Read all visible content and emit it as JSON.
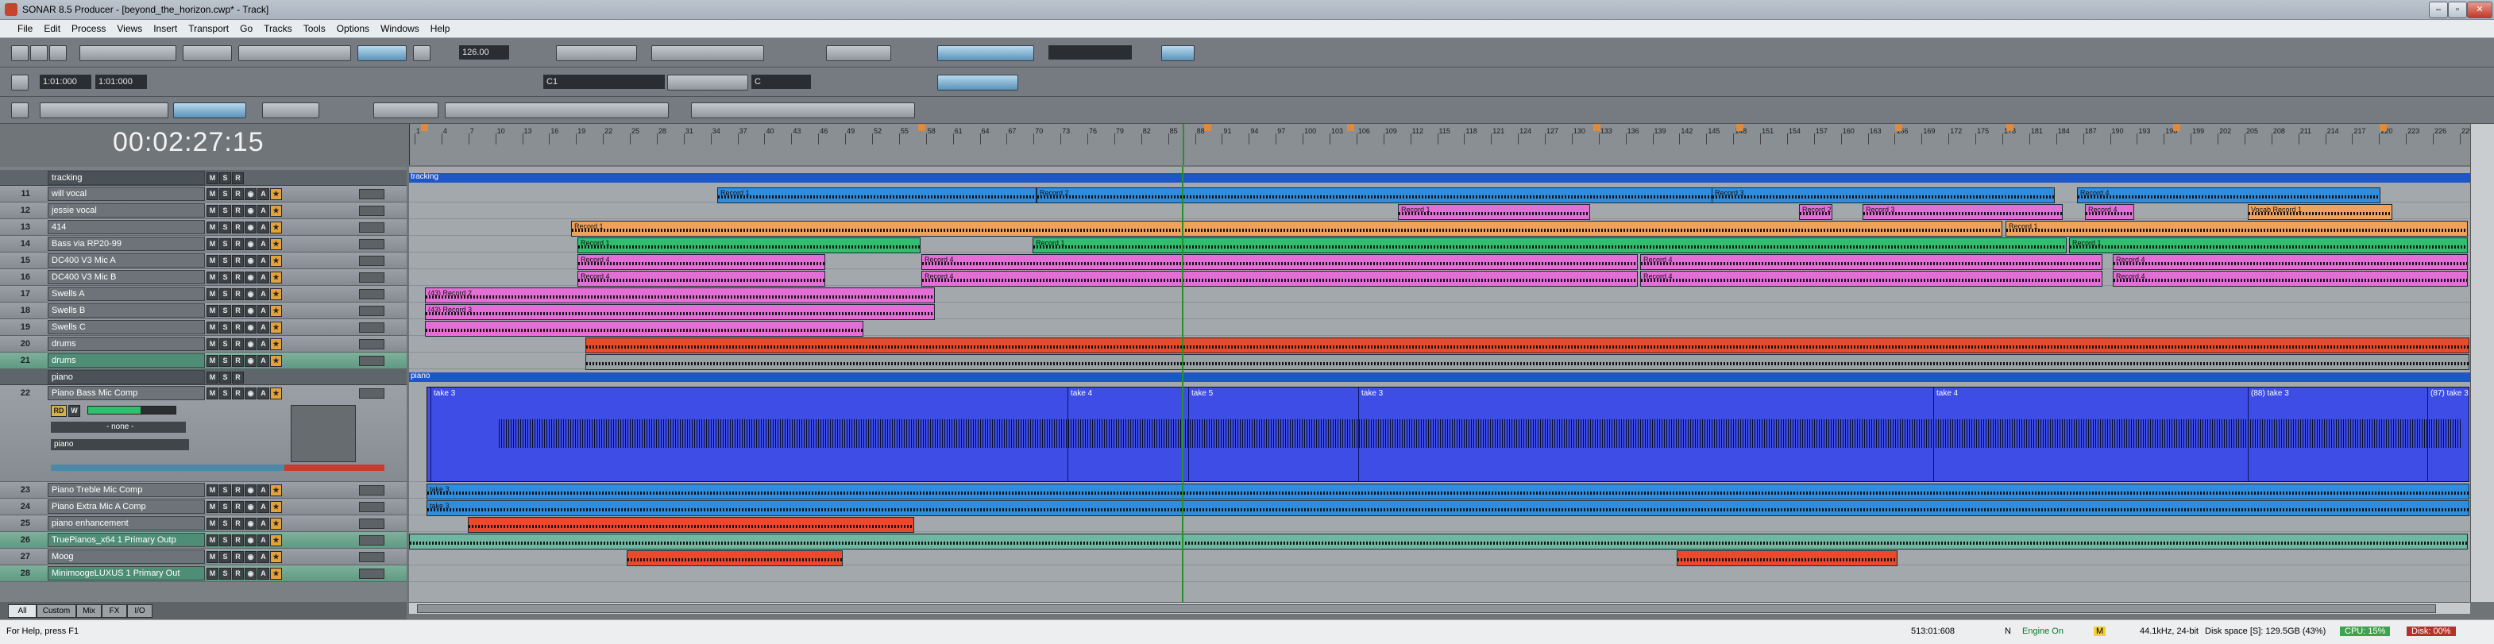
{
  "window": {
    "title": "SONAR 8.5 Producer - [beyond_the_horizon.cwp* - Track]",
    "buttons": [
      "–",
      "▫",
      "✕"
    ]
  },
  "menu": [
    "File",
    "Edit",
    "Process",
    "Views",
    "Insert",
    "Transport",
    "Go",
    "Tracks",
    "Tools",
    "Options",
    "Windows",
    "Help"
  ],
  "toolbar": {
    "tempo": "126.00",
    "loop_start": "1:01:000",
    "loop_end": "1:01:000",
    "snap_field": "C1",
    "key_field": "C"
  },
  "transport": {
    "time": "00:02:27:15"
  },
  "ruler": {
    "bars": [
      "1",
      "4",
      "7",
      "10",
      "13",
      "16",
      "19",
      "22",
      "25",
      "28",
      "31",
      "34",
      "37",
      "40",
      "43",
      "46",
      "49",
      "52",
      "55",
      "58",
      "61",
      "64",
      "67",
      "70",
      "73",
      "76",
      "79",
      "82",
      "85",
      "88",
      "91",
      "94",
      "97",
      "100",
      "103",
      "106",
      "109",
      "112",
      "115",
      "118",
      "121",
      "124",
      "127",
      "130",
      "133",
      "136",
      "139",
      "142",
      "145",
      "148",
      "151",
      "154",
      "157",
      "160",
      "163",
      "166",
      "169",
      "172",
      "175",
      "178",
      "181",
      "184",
      "187",
      "190",
      "193",
      "196",
      "199",
      "202",
      "205",
      "208",
      "211",
      "214",
      "217",
      "220",
      "223",
      "226",
      "229"
    ]
  },
  "tracks": [
    {
      "num": "",
      "name": "tracking",
      "kind": "folder"
    },
    {
      "num": "11",
      "name": "will vocal"
    },
    {
      "num": "12",
      "name": "jessie vocal"
    },
    {
      "num": "13",
      "name": "414"
    },
    {
      "num": "14",
      "name": "Bass via RP20-99"
    },
    {
      "num": "15",
      "name": "DC400 V3 Mic A"
    },
    {
      "num": "16",
      "name": "DC400 V3 Mic B"
    },
    {
      "num": "17",
      "name": "Swells A"
    },
    {
      "num": "18",
      "name": "Swells B"
    },
    {
      "num": "19",
      "name": "Swells C"
    },
    {
      "num": "20",
      "name": "drums"
    },
    {
      "num": "21",
      "name": "drums",
      "selected": true
    },
    {
      "num": "",
      "name": "piano",
      "kind": "folder"
    },
    {
      "num": "22",
      "name": "Piano Bass Mic Comp",
      "expanded": true
    },
    {
      "num": "23",
      "name": "Piano Treble Mic Comp"
    },
    {
      "num": "24",
      "name": "Piano Extra Mic A Comp"
    },
    {
      "num": "25",
      "name": "piano enhancement"
    },
    {
      "num": "26",
      "name": "TruePianos_x64 1 Primary Outp",
      "selected": true
    },
    {
      "num": "27",
      "name": "Moog"
    },
    {
      "num": "28",
      "name": "MinimoogeLUXUS 1 Primary Out",
      "selected": true
    }
  ],
  "track22": {
    "input": "piano",
    "none_label": "- none -",
    "rd": "RD",
    "w": "W",
    "sliders": "0.0"
  },
  "clips": {
    "folder_tracking": "tracking",
    "folder_piano": "piano",
    "record1": "Record 1",
    "record2": "Record 2",
    "record3": "Record 3",
    "record4": "Record 4",
    "vocab": "Vocab Record 1",
    "recordA": "(43) Record 2",
    "recordB": "(43) Record 3",
    "take3": "take 3",
    "take4": "take 4",
    "take5": "take 5",
    "take3b": "(88) take 3",
    "take3c": "(87) take 3"
  },
  "tabs": [
    "All",
    "Custom",
    "Mix",
    "FX",
    "I/O"
  ],
  "status": {
    "help": "For Help, press F1",
    "position": "513:01:608",
    "n": "N",
    "engine": "Engine On",
    "m": "M",
    "format": "44.1kHz, 24-bit",
    "disk": "Disk space [S]: 129.5GB (43%)",
    "cpu": "CPU: 15%",
    "diskio": "Disk: 00%"
  },
  "colors": {
    "blue_clip": "#2f8de0",
    "pink_clip": "#e36fd6",
    "orange_clip": "#f0a15a",
    "green_clip": "#2fbf6e",
    "red_clip": "#e94a2c",
    "piano_wave_bg": "#3d4de6",
    "folder_bar": "#1f56c7"
  }
}
